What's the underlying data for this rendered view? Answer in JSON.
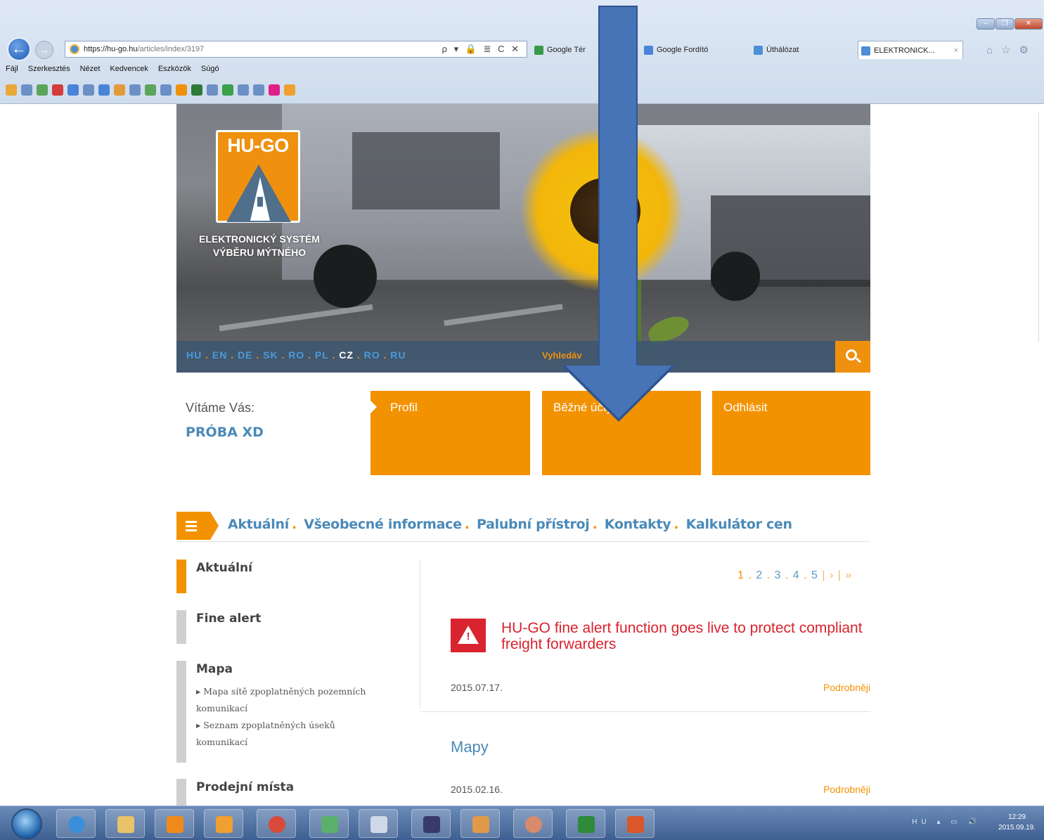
{
  "browser": {
    "url_host": "https://hu-go.hu",
    "url_path": "/articles/index/3197",
    "url_tools": "ρ ▾ 🔒 ≣ C ✕",
    "tabs": [
      {
        "label": "Google Tér"
      },
      {
        "label": "Google Fordító"
      },
      {
        "label": "Úthálózat"
      },
      {
        "label": "ELEKTRONICK..."
      }
    ],
    "menu": [
      "Fájl",
      "Szerkesztés",
      "Nézet",
      "Kedvencek",
      "Eszközök",
      "Súgó"
    ],
    "window_buttons": [
      "–",
      "❐",
      "✕"
    ]
  },
  "banner": {
    "logo_text": "HU-GO",
    "subtitle_line1": "ELEKTRONICKÝ SYSTÉM",
    "subtitle_line2": "VÝBĚRU MÝTNÉHO",
    "languages": [
      "HU",
      "EN",
      "DE",
      "SK",
      "RO",
      "PL",
      "CZ",
      "RO",
      "RU"
    ],
    "current_language": "CZ",
    "search_placeholder": "Vyhledáv"
  },
  "user": {
    "welcome": "Vítáme Vás:",
    "name": "PRÓBA XD"
  },
  "tiles": {
    "profile": "Profil",
    "accounts": "Běžné účty",
    "logout": "Odhlásit"
  },
  "mainnav": {
    "items": [
      "Aktuální",
      "Všeobecné informace",
      "Palubní přístroj",
      "Kontakty",
      "Kalkulátor cen"
    ]
  },
  "sidebar": {
    "items": [
      {
        "label": "Aktuální"
      },
      {
        "label": "Fine alert"
      },
      {
        "label": "Mapa",
        "sub": [
          "▸ Mapa sítě zpoplatněných pozemních",
          "komunikací",
          "▸ Seznam zpoplatněných úseků",
          "komunikací"
        ]
      },
      {
        "label": "Prodejní místa"
      }
    ]
  },
  "pager": {
    "pages": [
      "1",
      "2",
      "3",
      "4",
      "5"
    ],
    "next": "›",
    "last": "»",
    "current": "1"
  },
  "news": [
    {
      "title": "HU-GO fine alert function goes live to protect compliant freight forwarders",
      "date": "2015.07.17.",
      "more": "Podrobněji"
    },
    {
      "title": "Mapy",
      "date": "2015.02.16.",
      "more": "Podrobněji"
    }
  ],
  "taskbar": {
    "tray_lang": "HU",
    "clock_time": "12:29",
    "clock_date": "2015.09.19."
  },
  "colors": {
    "accent_orange": "#f39200",
    "link_blue": "#4a8ab8",
    "alert_red": "#d9232e",
    "overlay_arrow": "#4674b6"
  }
}
